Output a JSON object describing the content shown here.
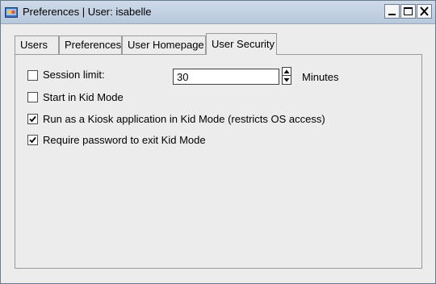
{
  "window": {
    "title": "Preferences | User: isabelle",
    "buttons": [
      "minimize",
      "maximize",
      "close"
    ]
  },
  "tabs": [
    {
      "label": "Users",
      "active": false
    },
    {
      "label": "Preferences",
      "active": false
    },
    {
      "label": "User Homepage",
      "active": false
    },
    {
      "label": "User Security",
      "active": true
    }
  ],
  "security": {
    "session_limit": {
      "label": "Session limit:",
      "checked": false
    },
    "session_minutes": {
      "value": "30",
      "unit_label": "Minutes"
    },
    "start_kid_mode": {
      "label": "Start in Kid Mode",
      "checked": false
    },
    "kiosk_mode": {
      "label": "Run as a Kiosk application in Kid Mode (restricts OS access)",
      "checked": true
    },
    "require_password": {
      "label": "Require password to exit Kid Mode",
      "checked": true
    }
  },
  "icons": {
    "app": "app-icon",
    "minimize": "minimize-icon",
    "maximize": "maximize-icon",
    "close": "close-icon",
    "spin_up": "arrow-up-icon",
    "spin_down": "arrow-down-icon",
    "check": "checkmark-icon"
  }
}
